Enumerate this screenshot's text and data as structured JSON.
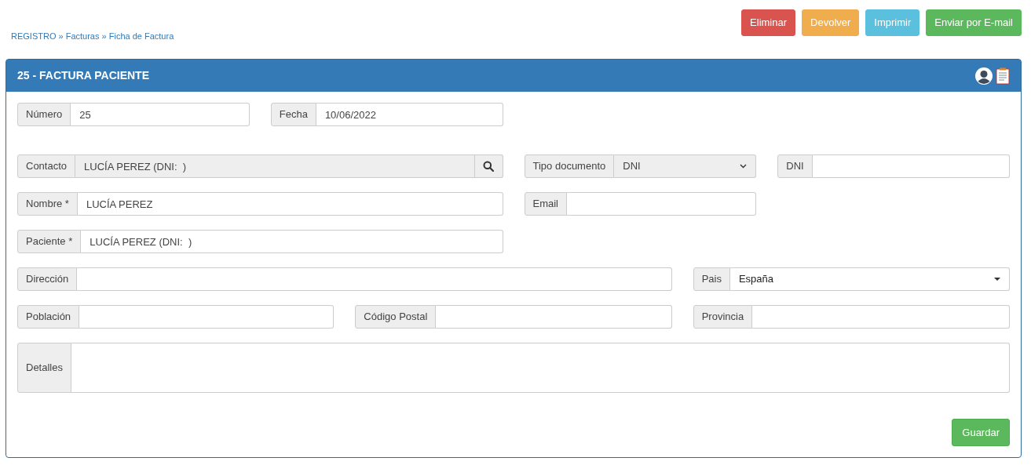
{
  "breadcrumb": {
    "separator": "»",
    "items": [
      {
        "label": "REGISTRO"
      },
      {
        "label": "Facturas"
      },
      {
        "label": "Ficha de Factura"
      }
    ]
  },
  "actions": [
    {
      "label": "Eliminar",
      "color": "#d9534f"
    },
    {
      "label": "Devolver",
      "color": "#f0ad4e"
    },
    {
      "label": "Imprimir",
      "color": "#5bc0de"
    },
    {
      "label": "Enviar por E-mail",
      "color": "#5cb85c"
    }
  ],
  "panel": {
    "title": "25 - FACTURA PACIENTE"
  },
  "form_rows": [
    [
      {
        "label": "Número",
        "kind": "text",
        "value": "25"
      },
      {
        "label": "Fecha",
        "kind": "text",
        "value": "10/06/2022"
      }
    ],
    [
      {
        "label": "Contacto",
        "kind": "search",
        "value": "LUCÍA PEREZ (DNI:  )"
      },
      {
        "label": "Tipo documento",
        "kind": "select",
        "value": "DNI"
      },
      {
        "label": "DNI",
        "kind": "text"
      }
    ],
    [
      {
        "label": "Nombre *",
        "kind": "text",
        "value": "LUCÍA PEREZ"
      },
      {
        "label": "Email",
        "kind": "text"
      }
    ],
    [
      {
        "label": "Paciente *",
        "kind": "text",
        "value": "LUCÍA PEREZ (DNI:  )"
      }
    ],
    [
      {
        "label": "Dirección",
        "kind": "text"
      },
      {
        "label": "Pais",
        "kind": "combo",
        "value": "España"
      }
    ],
    [
      {
        "label": "Población",
        "kind": "text"
      },
      {
        "label": "Código Postal",
        "kind": "text"
      },
      {
        "label": "Provincia",
        "kind": "text"
      }
    ],
    [
      {
        "label": "Detalles",
        "kind": "textarea"
      }
    ]
  ],
  "save_button": {
    "label": "Guardar"
  }
}
